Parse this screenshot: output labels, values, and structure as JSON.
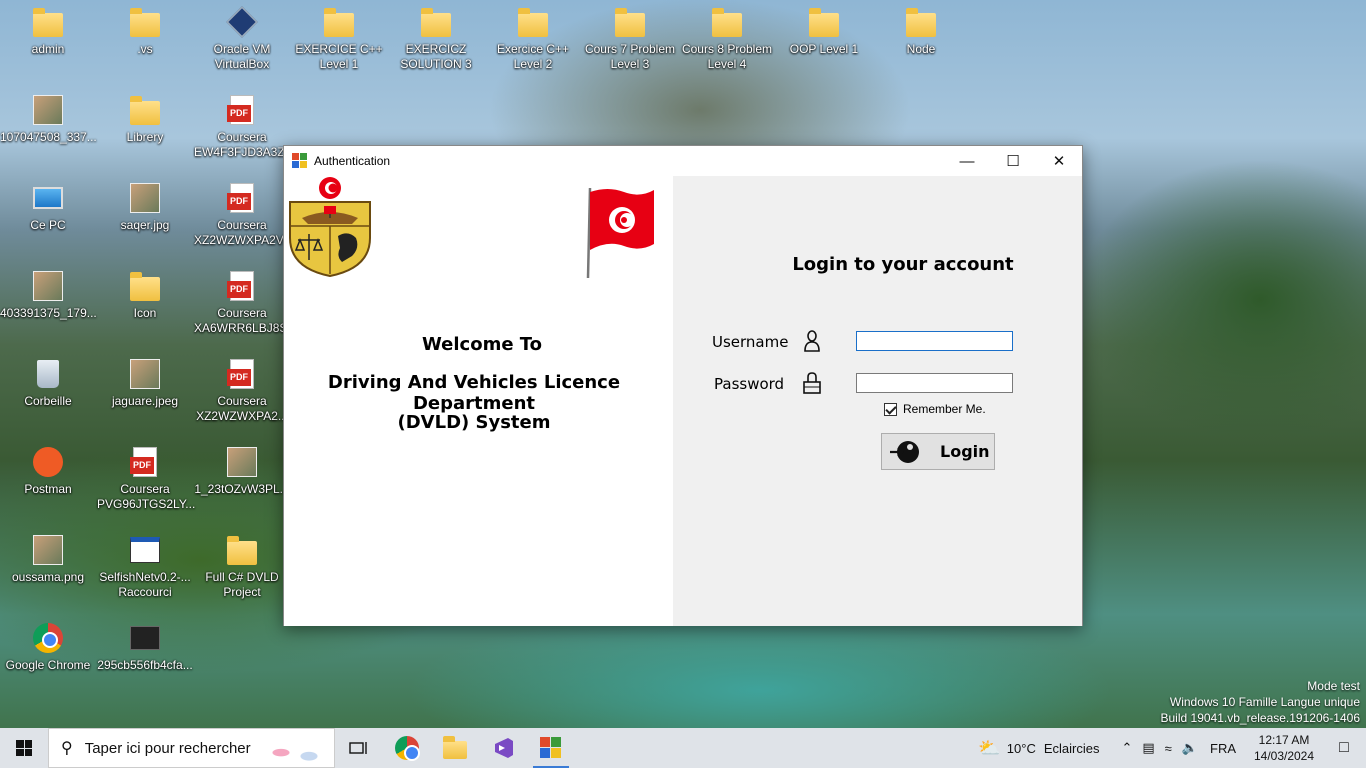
{
  "desktop": {
    "icons": [
      {
        "label": "admin",
        "kind": "folder-user"
      },
      {
        "label": ".vs",
        "kind": "folder"
      },
      {
        "label": "Oracle VM VirtualBox",
        "kind": "virtualbox"
      },
      {
        "label": "EXERCICE C++ Level 1",
        "kind": "folder"
      },
      {
        "label": "EXERCICZ SOLUTION 3",
        "kind": "folder"
      },
      {
        "label": "Exercice C++ Level 2",
        "kind": "folder"
      },
      {
        "label": "Cours 7 Problem Level 3",
        "kind": "folder"
      },
      {
        "label": "Cours 8 Problem Level 4",
        "kind": "folder"
      },
      {
        "label": "OOP Level 1",
        "kind": "folder"
      },
      {
        "label": "Node",
        "kind": "folder"
      },
      {
        "label": "107047508_337...",
        "kind": "photo"
      },
      {
        "label": "Librery",
        "kind": "folder"
      },
      {
        "label": "Coursera EW4F3FJD3A3Z...",
        "kind": "pdf"
      },
      {
        "label": "Ce PC",
        "kind": "pc"
      },
      {
        "label": "saqer.jpg",
        "kind": "photo"
      },
      {
        "label": "Coursera XZ2WZWXPA2V...",
        "kind": "pdf"
      },
      {
        "label": "403391375_179...",
        "kind": "photo"
      },
      {
        "label": "Icon",
        "kind": "folder"
      },
      {
        "label": "Coursera XA6WRR6LBJ8S...",
        "kind": "pdf"
      },
      {
        "label": "Corbeille",
        "kind": "recycle-bin"
      },
      {
        "label": "jaguare.jpeg",
        "kind": "photo"
      },
      {
        "label": "Coursera XZ2WZWXPA2...",
        "kind": "pdf"
      },
      {
        "label": "Postman",
        "kind": "postman"
      },
      {
        "label": "Coursera PVG96JTGS2LY...",
        "kind": "pdf"
      },
      {
        "label": "1_23tOZvW3PL...",
        "kind": "photo"
      },
      {
        "label": "oussama.png",
        "kind": "photo"
      },
      {
        "label": "SelfishNetv0.2-... Raccourci",
        "kind": "app"
      },
      {
        "label": "Full C# DVLD Project",
        "kind": "folder"
      },
      {
        "label": "Google Chrome",
        "kind": "chrome"
      },
      {
        "label": "295cb556fb4cfa...",
        "kind": "dark"
      }
    ],
    "watermark": {
      "line1": "Mode test",
      "line2": "Windows 10 Famille Langue unique",
      "line3": "Build 19041.vb_release.191206-1406"
    }
  },
  "window": {
    "title": "Authentication",
    "controls": {
      "minimize": "—",
      "maximize": "☐",
      "close": "✕"
    },
    "left": {
      "welcome_line1": "Welcome To",
      "welcome_line2": "Driving And Vehicles Licence Department",
      "welcome_line3": "(DVLD) System"
    },
    "right": {
      "heading": "Login to your account",
      "username_label": "Username",
      "username_value": "",
      "password_label": "Password",
      "password_value": "",
      "remember_label": "Remember Me.",
      "remember_checked": true,
      "login_button": "Login"
    }
  },
  "taskbar": {
    "search_placeholder": "Taper ici pour rechercher",
    "weather_temp": "10°C",
    "weather_text": "Eclaircies",
    "language": "FRA",
    "time": "12:17 AM",
    "date": "14/03/2024"
  },
  "colors": {
    "accent": "#1a6fc9",
    "flag_red": "#e70013",
    "emblem_gold": "#e8c640"
  }
}
